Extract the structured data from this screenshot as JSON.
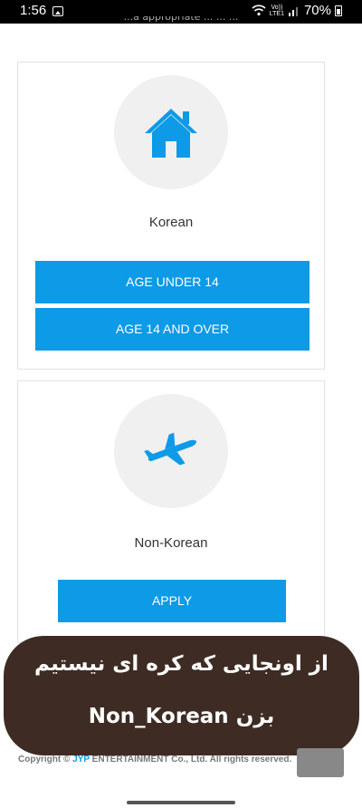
{
  "status_bar": {
    "time": "1:56",
    "network_label_top": "Vo))",
    "network_label_bottom": "LTE1",
    "battery": "70%"
  },
  "page": {
    "cutoff_text": "...a appropriate ... ... ..."
  },
  "korean_card": {
    "label": "Korean",
    "icon": "house-icon",
    "buttons": {
      "under14": "AGE UNDER 14",
      "over14": "AGE 14 AND OVER"
    }
  },
  "nonkorean_card": {
    "label": "Non-Korean",
    "icon": "airplane-icon",
    "buttons": {
      "apply": "APPLY"
    }
  },
  "overlay": {
    "line1": "از اونجایی که کره ای نیستیم",
    "line2": "بزن Non_Korean"
  },
  "footer": {
    "copyright_prefix": "Copyright ©",
    "brand": "JYP",
    "copyright_suffix": "ENTERTAINMENT Co., Ltd. All rights reserved."
  },
  "colors": {
    "accent": "#0d9ae6",
    "overlay_bg": "#3e2c24"
  }
}
